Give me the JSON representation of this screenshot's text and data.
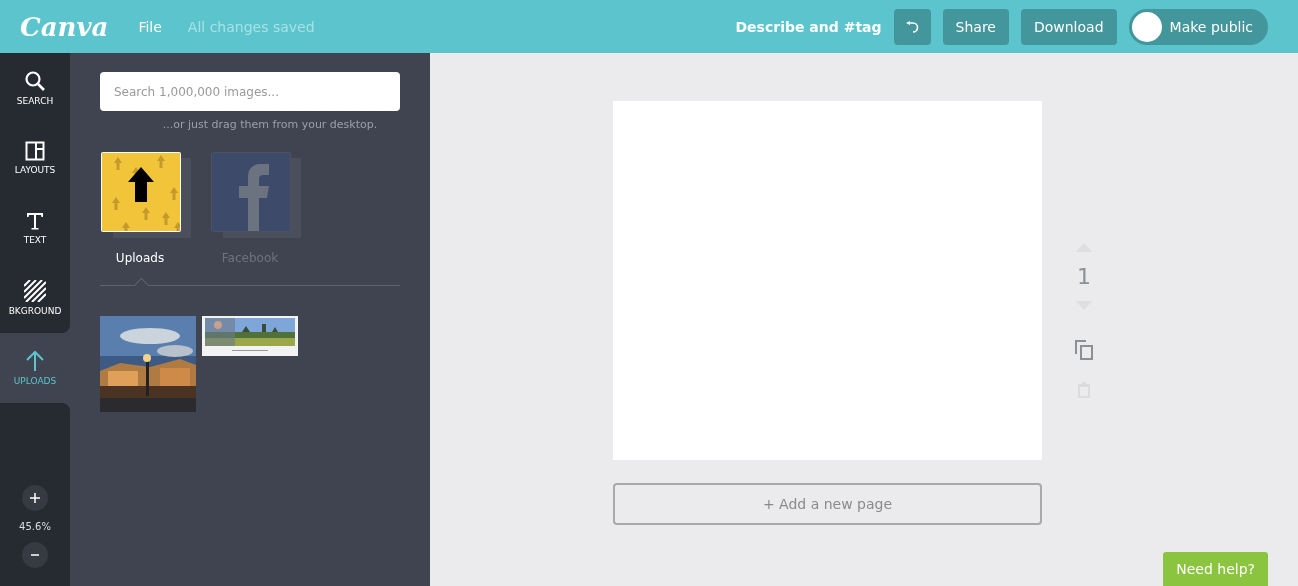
{
  "header": {
    "logo": "Canva",
    "menu": "File",
    "status": "All changes saved",
    "describe": "Describe and #tag",
    "share": "Share",
    "download": "Download",
    "public_toggle": {
      "label": "Make public",
      "on": false
    }
  },
  "rail": [
    {
      "label": "SEARCH",
      "selected": false
    },
    {
      "label": "LAYOUTS",
      "selected": false
    },
    {
      "label": "TEXT",
      "selected": false
    },
    {
      "label": "BKGROUND",
      "selected": false
    },
    {
      "label": "UPLOADS",
      "selected": true
    }
  ],
  "zoom": {
    "value": "45.6%"
  },
  "panel": {
    "search": {
      "placeholder": "Search 1,000,000 images..."
    },
    "hint": "...or just drag them from your desktop.",
    "sources": [
      {
        "label": "Uploads",
        "kind": "uploads",
        "selected": true
      },
      {
        "label": "Facebook",
        "kind": "facebook",
        "selected": false
      }
    ]
  },
  "page": {
    "number": "1",
    "add_page": "+ Add a new page"
  },
  "help": "Need help?"
}
